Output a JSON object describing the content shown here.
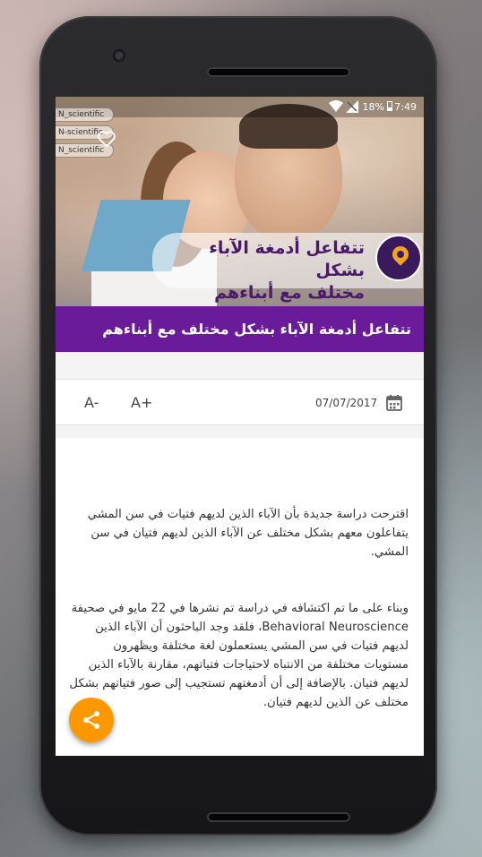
{
  "status_bar": {
    "battery": "18%",
    "time": "7:49"
  },
  "hero": {
    "tags": [
      "N_scientific",
      "N-scientific",
      "N_scientific"
    ],
    "caption": "تتفاعل أدمغة الآباء بشكل\nمختلف مع أبناءهم وبناتهم"
  },
  "article": {
    "title": "تتفاعل أدمغة الآباء بشكل مختلف مع أبناءهم وبناتهم",
    "date": "07/07/2017",
    "font_decrease_label": "A-",
    "font_increase_label": "A+",
    "paragraphs": [
      "اقترحت دراسة جديدة بأن الآباء الذين لديهم فتيات في سن المشي يتفاعلون معهم بشكل مختلف عن الآباء الذين لديهم فتيان في سن المشي.",
      "وبناء على ما تم اكتشافه في دراسة تم نشرها في 22 مايو في صحيفة Behavioral Neuroscience، فلقد وجد الباحثون أن الآباء الذين لديهم فتيات في سن المشي يستعملون لغة مختلفة ويظهرون مستويات مختلفة من الانتباه لاحتياجات فتياتهم، مقارنة بالآباء الذين لديهم فتيان. بالإضافة إلى أن أدمغتهم تستجيب إلى صور فتياتهم بشكل مختلف عن الذين لديهم فتيان."
    ]
  },
  "colors": {
    "title_bar": "#6a1b9a",
    "fab": "#ff9800"
  },
  "icons": {
    "favorite": "heart-outline-icon",
    "calendar": "calendar-icon",
    "share": "share-icon"
  }
}
